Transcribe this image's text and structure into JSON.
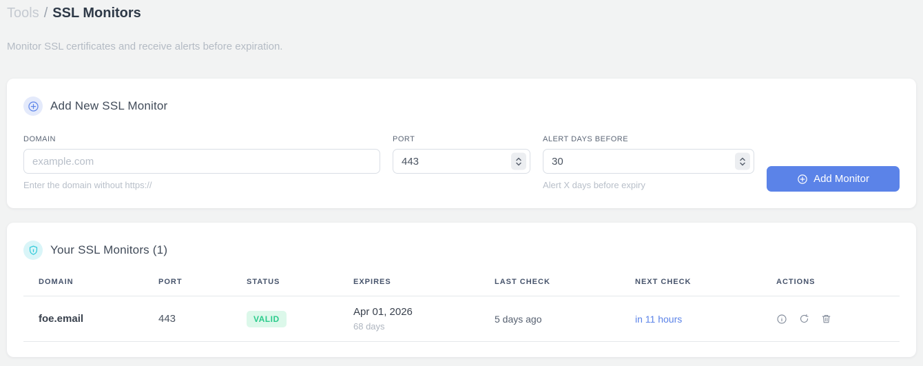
{
  "breadcrumb": {
    "section": "Tools",
    "separator": "/",
    "page": "SSL Monitors"
  },
  "subtitle": "Monitor SSL certificates and receive alerts before expiration.",
  "add_card": {
    "title": "Add New SSL Monitor",
    "fields": {
      "domain": {
        "label": "DOMAIN",
        "placeholder": "example.com",
        "helper": "Enter the domain without https://"
      },
      "port": {
        "label": "PORT",
        "value": "443"
      },
      "alert_days": {
        "label": "ALERT DAYS BEFORE",
        "value": "30",
        "helper": "Alert X days before expiry"
      }
    },
    "submit_label": "Add Monitor"
  },
  "monitors_card": {
    "title": "Your SSL Monitors (1)",
    "table": {
      "headers": [
        "DOMAIN",
        "PORT",
        "STATUS",
        "EXPIRES",
        "LAST CHECK",
        "NEXT CHECK",
        "ACTIONS"
      ],
      "rows": [
        {
          "domain": "foe.email",
          "port": "443",
          "status": "VALID",
          "expires_date": "Apr 01, 2026",
          "expires_days": "68 days",
          "last_check": "5 days ago",
          "next_check": "in 11 hours"
        }
      ]
    }
  },
  "icons": {
    "add_card_badge": "circle-plus",
    "monitors_card_badge": "shield-lock",
    "submit_button": "circle-plus",
    "row_actions": [
      "info-circle",
      "refresh",
      "trash"
    ],
    "number_steppers": "chevrons-up-down"
  },
  "colors": {
    "accent_blue": "#5b83e8",
    "accent_cyan": "#2fc9d9",
    "status_valid_text": "#2bcb8c",
    "status_valid_bg": "#dcf8ea",
    "page_background": "#f2f3f3"
  }
}
